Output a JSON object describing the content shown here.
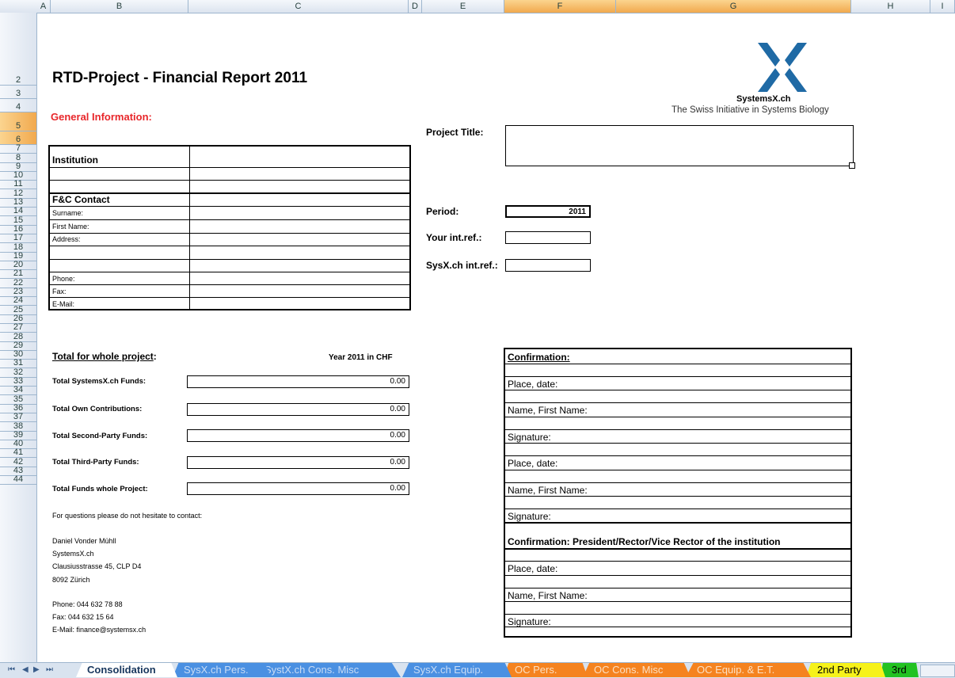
{
  "columns": [
    "A",
    "B",
    "C",
    "D",
    "E",
    "F",
    "G",
    "H",
    "I"
  ],
  "rows": [
    "2",
    "3",
    "4",
    "5",
    "6",
    "7",
    "8",
    "9",
    "10",
    "11",
    "12",
    "13",
    "14",
    "15",
    "16",
    "17",
    "18",
    "19",
    "20",
    "21",
    "22",
    "23",
    "24",
    "25",
    "26",
    "27",
    "28",
    "29",
    "30",
    "31",
    "32",
    "33",
    "34",
    "35",
    "36",
    "37",
    "38",
    "39",
    "40",
    "41",
    "42",
    "43",
    "44"
  ],
  "title": "RTD-Project - Financial Report 2011",
  "general_info": "General Information:",
  "logo": {
    "name": "SystemsX.ch",
    "tagline": "The Swiss Initiative in Systems Biology",
    "color": "#1f6aa5"
  },
  "project": {
    "title_label": "Project Title:",
    "title_value": "",
    "period_label": "Period:",
    "period_value": "2011",
    "your_ref_label": "Your int.ref.:",
    "your_ref_value": "",
    "sysx_ref_label": "SysX.ch int.ref.:",
    "sysx_ref_value": ""
  },
  "institution_table": {
    "institution": "Institution",
    "fc_contact": "F&C Contact",
    "surname": "Surname:",
    "first_name": "First Name:",
    "address": "Address:",
    "phone": "Phone:",
    "fax": "Fax:",
    "email": "E-Mail:"
  },
  "totals": {
    "heading": "Total for whole project",
    "heading_suffix": ":",
    "year_label": "Year 2011 in CHF",
    "items": [
      {
        "label": "Total SystemsX.ch Funds:",
        "value": "0.00"
      },
      {
        "label": "Total Own Contributions:",
        "value": "0.00"
      },
      {
        "label": "Total Second-Party Funds:",
        "value": "0.00"
      },
      {
        "label": "Total Third-Party Funds:",
        "value": "0.00"
      },
      {
        "label": "Total Funds whole Project:",
        "value": "0.00"
      }
    ]
  },
  "contact": {
    "intro": "For questions please do not hesitate to contact:",
    "name": "Daniel Vonder Mühll",
    "org": "SystemsX.ch",
    "street": "Clausiusstrasse 45, CLP D4",
    "city": "8092 Zürich",
    "phone": "Phone:  044 632 78 88",
    "fax": "Fax:     044 632 15 64",
    "email": "E-Mail: finance@systemsx.ch"
  },
  "confirmation": {
    "heading": "Confirmation:",
    "place_date": "Place, date:",
    "name": "Name, First Name:",
    "signature": "Signature:",
    "heading2": "Confirmation: President/Rector/Vice Rector of the institution"
  },
  "tabs": [
    {
      "label": "Consolidation",
      "color": "#ffffff",
      "text_color": "#17365d"
    },
    {
      "label": "SysX.ch Pers.",
      "color": "#4a90e2",
      "text_color": "#c9dcf5"
    },
    {
      "label": "SystX.ch Cons. Misc",
      "color": "#4a90e2",
      "text_color": "#c9dcf5"
    },
    {
      "label": "SysX.ch Equip.",
      "color": "#4a90e2",
      "text_color": "#c9dcf5"
    },
    {
      "label": "OC Pers.",
      "color": "#f5831f",
      "text_color": "#fde0c2"
    },
    {
      "label": "OC Cons. Misc",
      "color": "#f5831f",
      "text_color": "#fde0c2"
    },
    {
      "label": "OC Equip. & E.T.",
      "color": "#f5831f",
      "text_color": "#fde0c2"
    },
    {
      "label": "2nd Party",
      "color": "#f6f21a",
      "text_color": "#000000"
    },
    {
      "label": "3rd",
      "color": "#22c222",
      "text_color": "#000000"
    }
  ]
}
